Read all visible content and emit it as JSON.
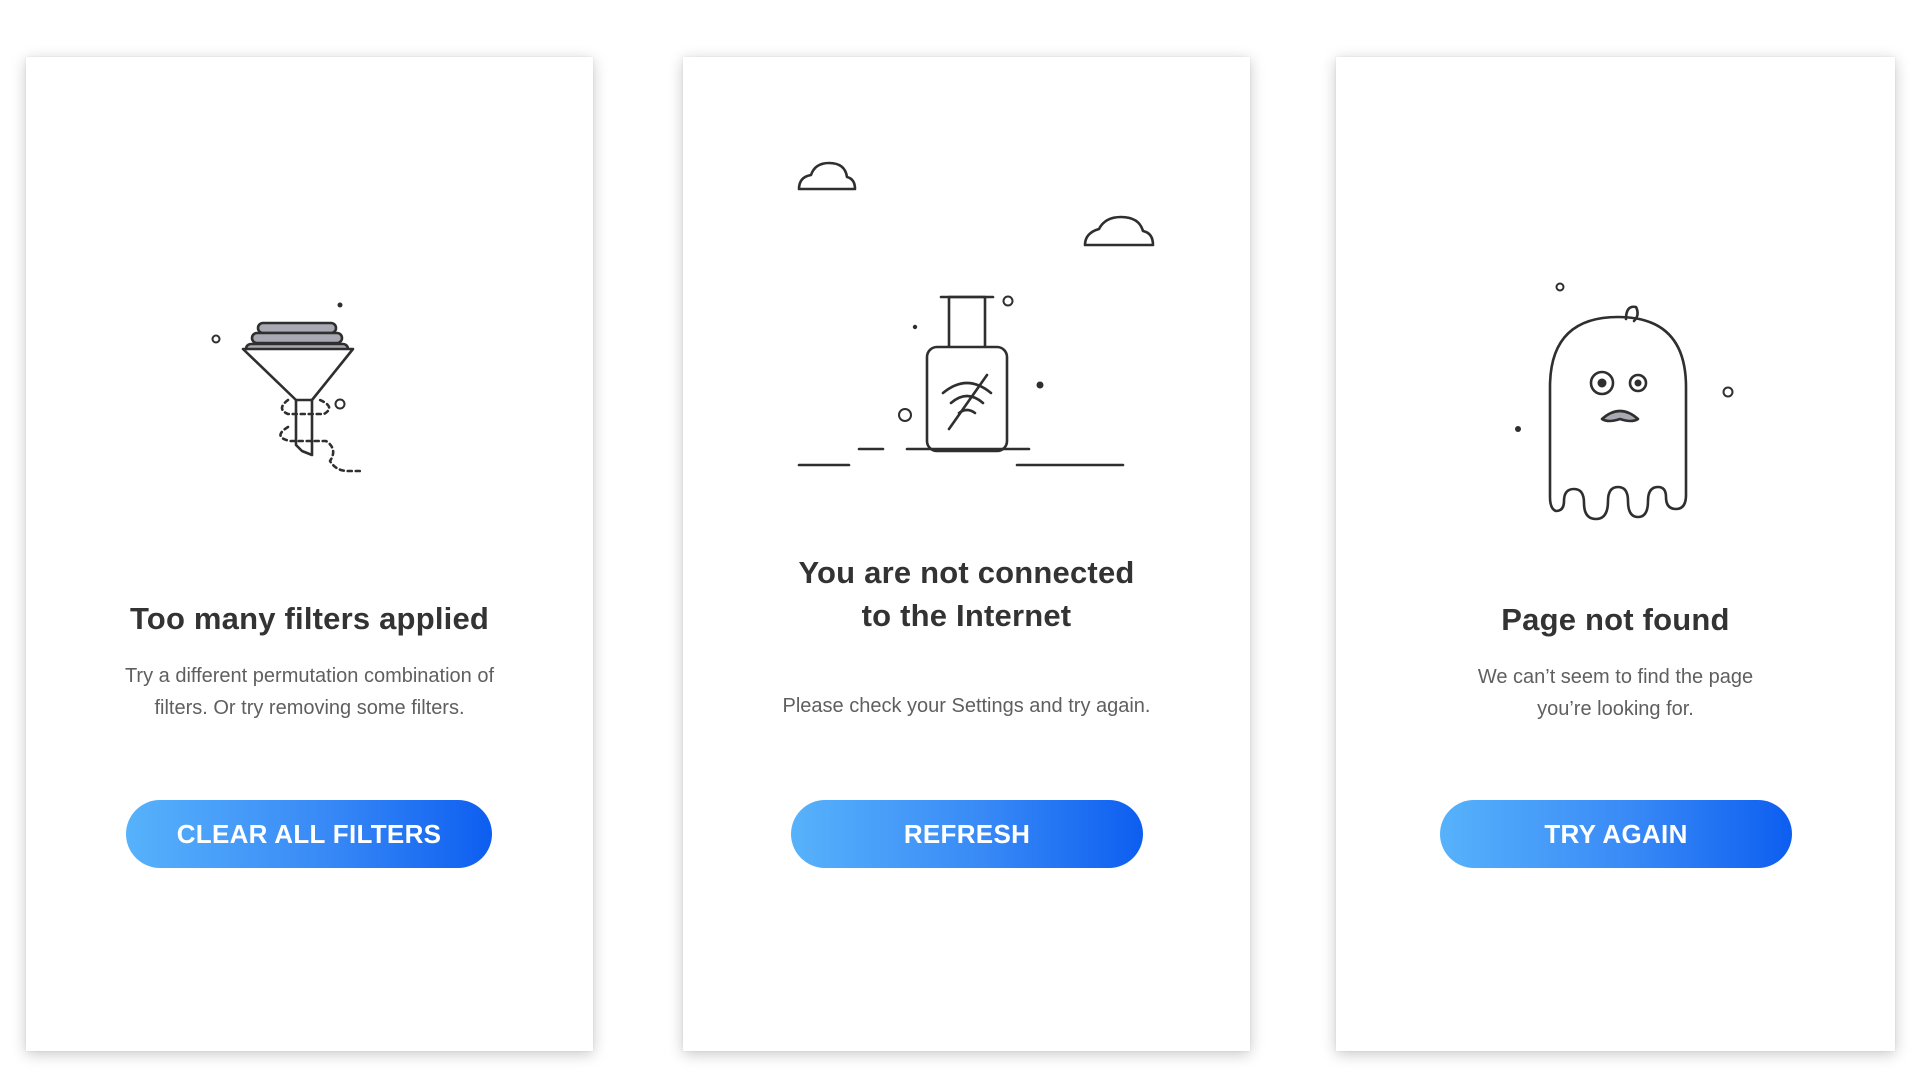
{
  "colors": {
    "stroke": "#2f2f2f",
    "filter_cap": "#a9a9b3",
    "ghost_mouth": "#a9a9b3",
    "button_gradient_start": "#57b2fb",
    "button_gradient_end": "#0d5ef0",
    "title_text": "#333333",
    "body_text": "#5f5f5f"
  },
  "cards": [
    {
      "illustration": "funnel-icon",
      "title_lines": [
        "Too many filters applied"
      ],
      "description_lines": [
        "Try a different permutation combination of",
        "filters. Or try removing some filters."
      ],
      "button_label": "CLEAR ALL FILTERS"
    },
    {
      "illustration": "suitcase-no-wifi-icon",
      "title_lines": [
        "You are not connected",
        "to the Internet"
      ],
      "description_lines": [
        "Please check your Settings and try again."
      ],
      "button_label": "REFRESH"
    },
    {
      "illustration": "ghost-icon",
      "title_lines": [
        "Page not found"
      ],
      "description_lines": [
        "We can’t seem to find the page",
        "you’re looking for."
      ],
      "button_label": "TRY AGAIN"
    }
  ]
}
